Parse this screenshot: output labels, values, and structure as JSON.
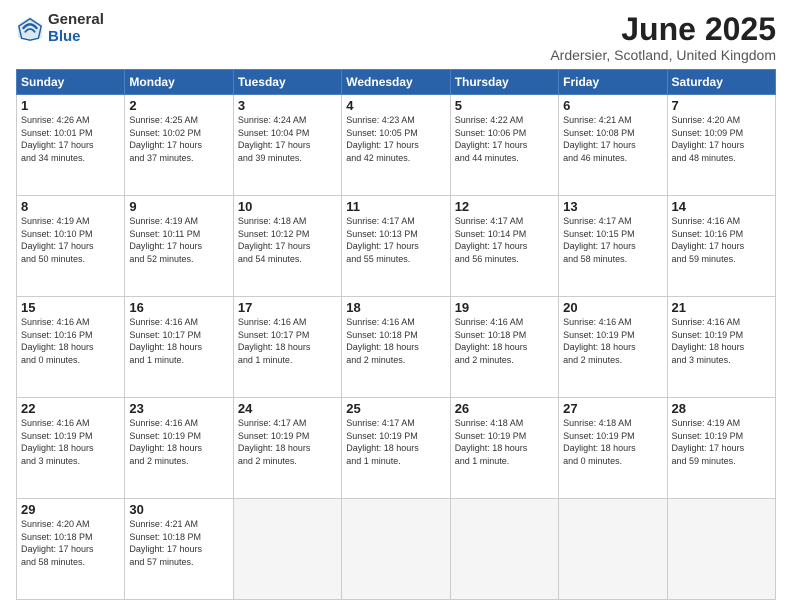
{
  "logo": {
    "general": "General",
    "blue": "Blue"
  },
  "title": "June 2025",
  "location": "Ardersier, Scotland, United Kingdom",
  "days_header": [
    "Sunday",
    "Monday",
    "Tuesday",
    "Wednesday",
    "Thursday",
    "Friday",
    "Saturday"
  ],
  "weeks": [
    [
      {
        "day": 1,
        "info": "Sunrise: 4:26 AM\nSunset: 10:01 PM\nDaylight: 17 hours\nand 34 minutes."
      },
      {
        "day": 2,
        "info": "Sunrise: 4:25 AM\nSunset: 10:02 PM\nDaylight: 17 hours\nand 37 minutes."
      },
      {
        "day": 3,
        "info": "Sunrise: 4:24 AM\nSunset: 10:04 PM\nDaylight: 17 hours\nand 39 minutes."
      },
      {
        "day": 4,
        "info": "Sunrise: 4:23 AM\nSunset: 10:05 PM\nDaylight: 17 hours\nand 42 minutes."
      },
      {
        "day": 5,
        "info": "Sunrise: 4:22 AM\nSunset: 10:06 PM\nDaylight: 17 hours\nand 44 minutes."
      },
      {
        "day": 6,
        "info": "Sunrise: 4:21 AM\nSunset: 10:08 PM\nDaylight: 17 hours\nand 46 minutes."
      },
      {
        "day": 7,
        "info": "Sunrise: 4:20 AM\nSunset: 10:09 PM\nDaylight: 17 hours\nand 48 minutes."
      }
    ],
    [
      {
        "day": 8,
        "info": "Sunrise: 4:19 AM\nSunset: 10:10 PM\nDaylight: 17 hours\nand 50 minutes."
      },
      {
        "day": 9,
        "info": "Sunrise: 4:19 AM\nSunset: 10:11 PM\nDaylight: 17 hours\nand 52 minutes."
      },
      {
        "day": 10,
        "info": "Sunrise: 4:18 AM\nSunset: 10:12 PM\nDaylight: 17 hours\nand 54 minutes."
      },
      {
        "day": 11,
        "info": "Sunrise: 4:17 AM\nSunset: 10:13 PM\nDaylight: 17 hours\nand 55 minutes."
      },
      {
        "day": 12,
        "info": "Sunrise: 4:17 AM\nSunset: 10:14 PM\nDaylight: 17 hours\nand 56 minutes."
      },
      {
        "day": 13,
        "info": "Sunrise: 4:17 AM\nSunset: 10:15 PM\nDaylight: 17 hours\nand 58 minutes."
      },
      {
        "day": 14,
        "info": "Sunrise: 4:16 AM\nSunset: 10:16 PM\nDaylight: 17 hours\nand 59 minutes."
      }
    ],
    [
      {
        "day": 15,
        "info": "Sunrise: 4:16 AM\nSunset: 10:16 PM\nDaylight: 18 hours\nand 0 minutes."
      },
      {
        "day": 16,
        "info": "Sunrise: 4:16 AM\nSunset: 10:17 PM\nDaylight: 18 hours\nand 1 minute."
      },
      {
        "day": 17,
        "info": "Sunrise: 4:16 AM\nSunset: 10:17 PM\nDaylight: 18 hours\nand 1 minute."
      },
      {
        "day": 18,
        "info": "Sunrise: 4:16 AM\nSunset: 10:18 PM\nDaylight: 18 hours\nand 2 minutes."
      },
      {
        "day": 19,
        "info": "Sunrise: 4:16 AM\nSunset: 10:18 PM\nDaylight: 18 hours\nand 2 minutes."
      },
      {
        "day": 20,
        "info": "Sunrise: 4:16 AM\nSunset: 10:19 PM\nDaylight: 18 hours\nand 2 minutes."
      },
      {
        "day": 21,
        "info": "Sunrise: 4:16 AM\nSunset: 10:19 PM\nDaylight: 18 hours\nand 3 minutes."
      }
    ],
    [
      {
        "day": 22,
        "info": "Sunrise: 4:16 AM\nSunset: 10:19 PM\nDaylight: 18 hours\nand 3 minutes."
      },
      {
        "day": 23,
        "info": "Sunrise: 4:16 AM\nSunset: 10:19 PM\nDaylight: 18 hours\nand 2 minutes."
      },
      {
        "day": 24,
        "info": "Sunrise: 4:17 AM\nSunset: 10:19 PM\nDaylight: 18 hours\nand 2 minutes."
      },
      {
        "day": 25,
        "info": "Sunrise: 4:17 AM\nSunset: 10:19 PM\nDaylight: 18 hours\nand 1 minute."
      },
      {
        "day": 26,
        "info": "Sunrise: 4:18 AM\nSunset: 10:19 PM\nDaylight: 18 hours\nand 1 minute."
      },
      {
        "day": 27,
        "info": "Sunrise: 4:18 AM\nSunset: 10:19 PM\nDaylight: 18 hours\nand 0 minutes."
      },
      {
        "day": 28,
        "info": "Sunrise: 4:19 AM\nSunset: 10:19 PM\nDaylight: 17 hours\nand 59 minutes."
      }
    ],
    [
      {
        "day": 29,
        "info": "Sunrise: 4:20 AM\nSunset: 10:18 PM\nDaylight: 17 hours\nand 58 minutes."
      },
      {
        "day": 30,
        "info": "Sunrise: 4:21 AM\nSunset: 10:18 PM\nDaylight: 17 hours\nand 57 minutes."
      },
      null,
      null,
      null,
      null,
      null
    ]
  ]
}
